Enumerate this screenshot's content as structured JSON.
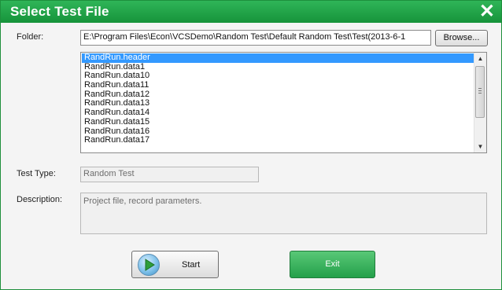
{
  "dialog": {
    "title": "Select Test File",
    "close_icon": "close-icon"
  },
  "folder": {
    "label": "Folder:",
    "value": "E:\\Program Files\\Econ\\VCSDemo\\Random Test\\Default Random Test\\Test(2013-6-1",
    "browse_label": "Browse..."
  },
  "files": {
    "selected": "RandRun.header",
    "items": [
      "RandRun.header",
      "RandRun.data1",
      "RandRun.data10",
      "RandRun.data11",
      "RandRun.data12",
      "RandRun.data13",
      "RandRun.data14",
      "RandRun.data15",
      "RandRun.data16",
      "RandRun.data17"
    ]
  },
  "test_type": {
    "label": "Test Type:",
    "value": "Random Test"
  },
  "description": {
    "label": "Description:",
    "value": "Project file, record parameters."
  },
  "buttons": {
    "start_label": "Start",
    "start_icon": "play-icon",
    "exit_label": "Exit"
  },
  "colors": {
    "titlebar": "#1fa347",
    "selection": "#3399ff",
    "exit_button": "#2fad55"
  }
}
